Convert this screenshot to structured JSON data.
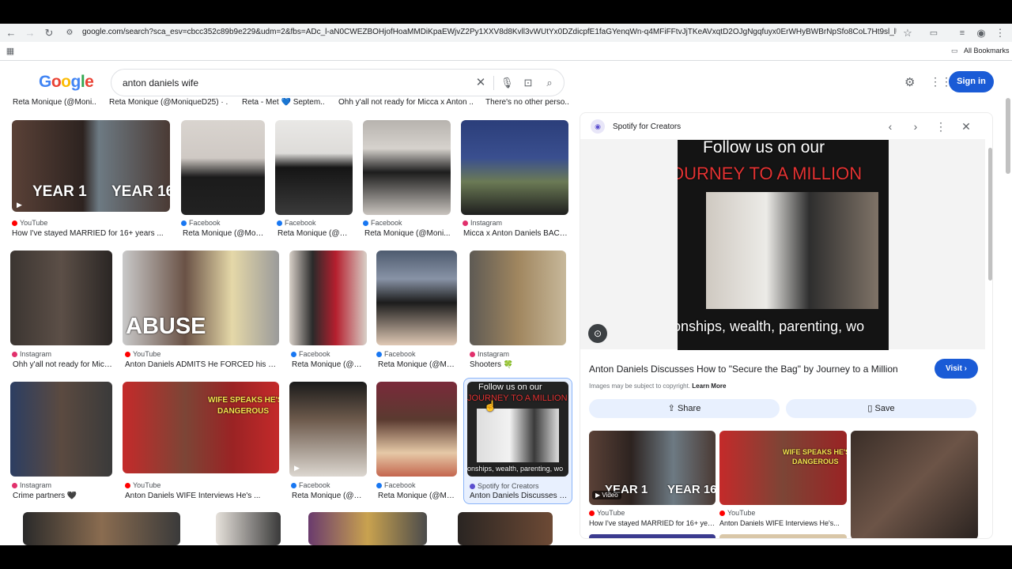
{
  "browser": {
    "url": "google.com/search?sca_esv=cbcc352c89b9e229&udm=2&fbs=ADc_l-aN0CWEZBOHjofHoaMMDiKpaEWjvZ2Py1XXV8d8Kvll3vWUtYx0DZdicpfE1faGYenqWn-q4MFiFFtvJjTKeAVxqtD2OJgNgqfuyx0ErWHyBWBrNpSfo8CoL7Ht9sl_lUf5bA8gr_l0uTHVh8Y...",
    "bookmarks_label": "All Bookmarks"
  },
  "google": {
    "logo": "Google",
    "query": "anton daniels wife",
    "sign_in": "Sign in"
  },
  "cut_row": [
    "Reta Monique (@Moni...",
    "Reta Monique (@MoniqueD25) · ...",
    "Reta - Met 💙 Septem...",
    "Ohh y'all not ready for Micca x Anton ...",
    "There's no other perso..."
  ],
  "results": [
    {
      "source": "YouTube",
      "title": "How I've stayed MARRIED for 16+ years ..."
    },
    {
      "source": "Facebook",
      "title": "Reta Monique (@Mon..."
    },
    {
      "source": "Facebook",
      "title": "Reta Monique (@M..."
    },
    {
      "source": "Facebook",
      "title": "Reta Monique (@Moni..."
    },
    {
      "source": "Instagram",
      "title": "Micca x Anton Daniels BACK ..."
    },
    {
      "source": "Instagram",
      "title": "Ohh y'all not ready for Micc..."
    },
    {
      "source": "YouTube",
      "title": "Anton Daniels ADMITS He FORCED his WIF..."
    },
    {
      "source": "Facebook",
      "title": "Reta Monique (@M..."
    },
    {
      "source": "Facebook",
      "title": "Reta Monique (@Mo..."
    },
    {
      "source": "Instagram",
      "title": "Shooters 🍀"
    },
    {
      "source": "Instagram",
      "title": "Crime partners 🖤"
    },
    {
      "source": "YouTube",
      "title": "Anton Daniels WIFE Interviews He's ..."
    },
    {
      "source": "Facebook",
      "title": "Reta Monique (@M..."
    },
    {
      "source": "Facebook",
      "title": "Reta Monique (@Mo..."
    },
    {
      "source": "Spotify for Creators",
      "title": "Anton Daniels Discusses H..."
    }
  ],
  "overlays": {
    "year1": "YEAR 1",
    "year16": "YEAR 16",
    "abuse": "ABUSE",
    "wife_speaks": "WIFE SPEAKS HE'S",
    "dangerous": "DANGEROUS",
    "follow": "Follow us on our",
    "journey": "JOURNEY TO A MILLION",
    "ships": "onships, wealth, parenting, wo"
  },
  "panel": {
    "source": "Spotify for Creators",
    "title": "Anton Daniels Discusses How to \"Secure the Bag\" by Journey to a Million",
    "visit": "Visit",
    "copyright": "Images may be subject to copyright.",
    "learn_more": "Learn More",
    "share": "Share",
    "save": "Save",
    "video_badge": "Video",
    "related": [
      {
        "source": "YouTube",
        "title": "How I've stayed MARRIED for 16+ years..."
      },
      {
        "source": "YouTube",
        "title": "Anton Daniels WIFE Interviews He's..."
      }
    ]
  },
  "colors": {
    "accent": "#1a5bd6",
    "youtube": "#ff0000",
    "facebook": "#1877f2",
    "instagram": "#e1306c",
    "spotify_creators": "#5b4fcf"
  }
}
